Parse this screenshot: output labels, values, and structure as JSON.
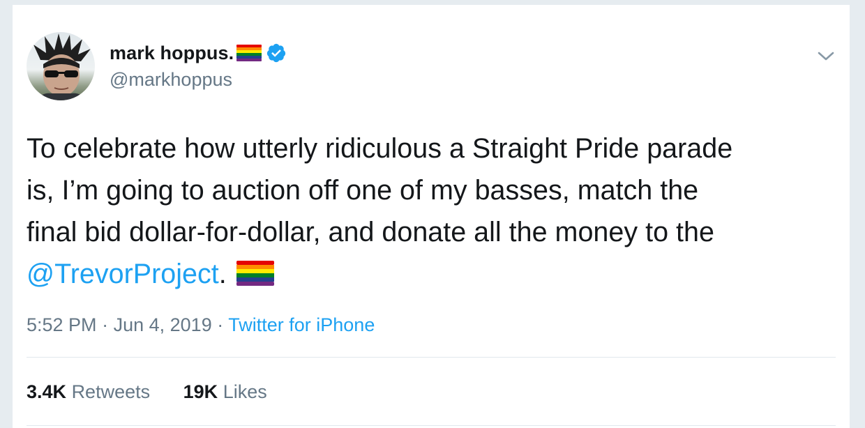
{
  "tweet": {
    "author": {
      "display_name": "mark hoppus.",
      "handle": "@markhoppus",
      "verified": true
    },
    "text_lines": [
      "To celebrate how utterly ridiculous a Straight Pride parade",
      "is, I’m going to auction off one of my basses, match the",
      "final bid dollar-for-dollar, and donate all the money to the"
    ],
    "mention": "@TrevorProject",
    "after_mention": ".",
    "time": "5:52 PM",
    "separator": "·",
    "date": "Jun 4, 2019",
    "source": "Twitter for iPhone",
    "retweets": {
      "count": "3.4K",
      "label": "Retweets"
    },
    "likes": {
      "count": "19K",
      "label": "Likes"
    }
  },
  "icons": {
    "flag": "rainbow-flag-icon",
    "verified": "verified-badge-icon",
    "menu": "chevron-down-icon"
  },
  "colors": {
    "background": "#e6ecf0",
    "card": "#ffffff",
    "text": "#14171a",
    "secondary": "#657786",
    "link": "#1da1f2",
    "divider": "#e1e8ed"
  }
}
